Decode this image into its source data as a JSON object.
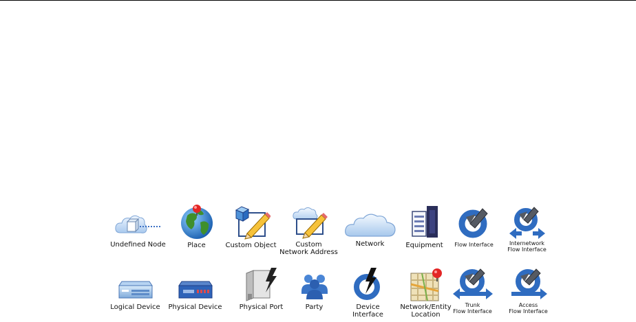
{
  "legend": {
    "row1": [
      {
        "icon": "cloud-node-icon",
        "label": "Undefined Node"
      },
      {
        "icon": "globe-pin-icon",
        "label": "Place"
      },
      {
        "icon": "cube-pencil-icon",
        "label": "Custom Object"
      },
      {
        "icon": "cloud-pencil-icon",
        "label": "Custom\nNetwork Address"
      },
      {
        "icon": "cloud-icon",
        "label": "Network"
      },
      {
        "icon": "equipment-rack-icon",
        "label": "Equipment"
      },
      {
        "icon": "flow-interface-icon",
        "label": "Flow Interface"
      },
      {
        "icon": "internetwork-flow-icon",
        "label": "Internetwork\nFlow Interface"
      }
    ],
    "row2": [
      {
        "icon": "logical-device-icon",
        "label": "Logical Device"
      },
      {
        "icon": "physical-device-icon",
        "label": "Physical Device"
      },
      {
        "icon": "physical-port-icon",
        "label": "Physical Port"
      },
      {
        "icon": "party-people-icon",
        "label": "Party"
      },
      {
        "icon": "device-interface-icon",
        "label": "Device\nInterface"
      },
      {
        "icon": "location-map-icon",
        "label": "Network/Entity\nLocation"
      },
      {
        "icon": "trunk-flow-icon",
        "label": "Trunk\nFlow Interface"
      },
      {
        "icon": "access-flow-icon",
        "label": "Access\nFlow Interface"
      }
    ]
  },
  "colors": {
    "blue": "#3a6fc4",
    "dark_blue": "#1c3e86",
    "light_blue": "#cfe2f7",
    "red": "#d73027",
    "navy": "#2a2e5a"
  }
}
